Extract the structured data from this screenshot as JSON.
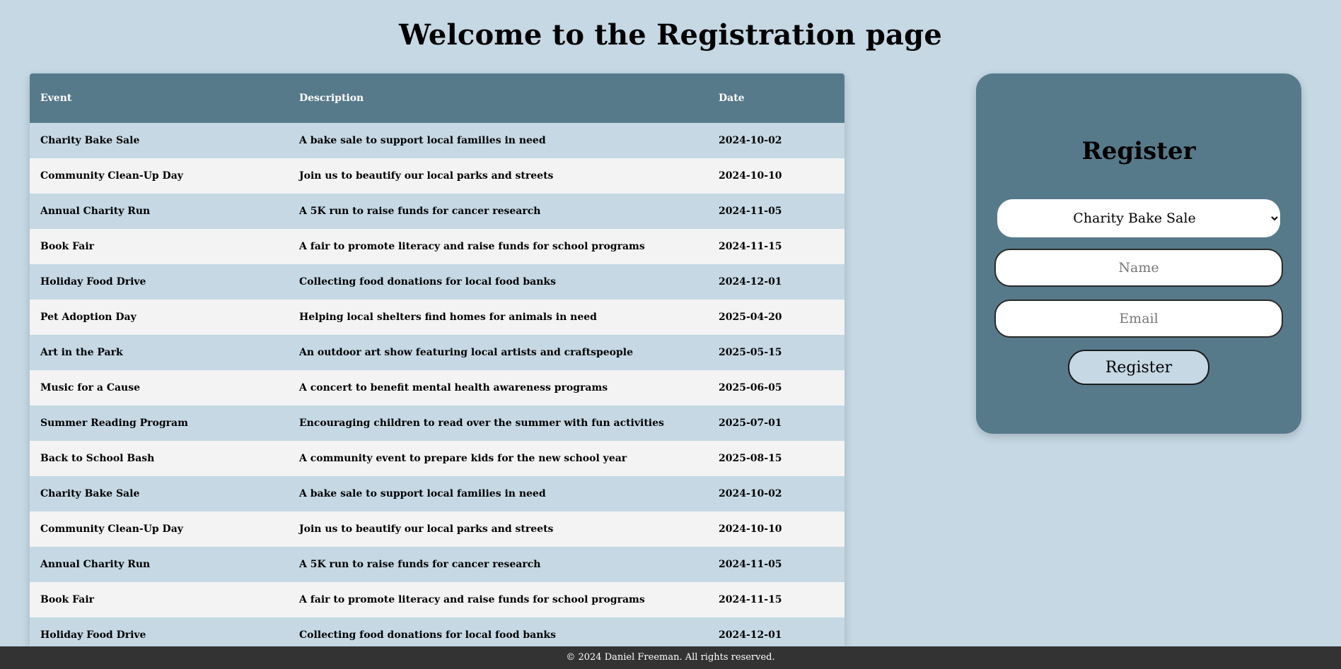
{
  "page": {
    "title": "Welcome to the Registration page"
  },
  "table": {
    "headers": {
      "event": "Event",
      "description": "Description",
      "date": "Date"
    },
    "rows": [
      {
        "event": "Charity Bake Sale",
        "description": "A bake sale to support local families in need",
        "date": "2024-10-02"
      },
      {
        "event": "Community Clean-Up Day",
        "description": "Join us to beautify our local parks and streets",
        "date": "2024-10-10"
      },
      {
        "event": "Annual Charity Run",
        "description": "A 5K run to raise funds for cancer research",
        "date": "2024-11-05"
      },
      {
        "event": "Book Fair",
        "description": "A fair to promote literacy and raise funds for school programs",
        "date": "2024-11-15"
      },
      {
        "event": "Holiday Food Drive",
        "description": "Collecting food donations for local food banks",
        "date": "2024-12-01"
      },
      {
        "event": "Pet Adoption Day",
        "description": "Helping local shelters find homes for animals in need",
        "date": "2025-04-20"
      },
      {
        "event": "Art in the Park",
        "description": "An outdoor art show featuring local artists and craftspeople",
        "date": "2025-05-15"
      },
      {
        "event": "Music for a Cause",
        "description": "A concert to benefit mental health awareness programs",
        "date": "2025-06-05"
      },
      {
        "event": "Summer Reading Program",
        "description": "Encouraging children to read over the summer with fun activities",
        "date": "2025-07-01"
      },
      {
        "event": "Back to School Bash",
        "description": "A community event to prepare kids for the new school year",
        "date": "2025-08-15"
      },
      {
        "event": "Charity Bake Sale",
        "description": "A bake sale to support local families in need",
        "date": "2024-10-02"
      },
      {
        "event": "Community Clean-Up Day",
        "description": "Join us to beautify our local parks and streets",
        "date": "2024-10-10"
      },
      {
        "event": "Annual Charity Run",
        "description": "A 5K run to raise funds for cancer research",
        "date": "2024-11-05"
      },
      {
        "event": "Book Fair",
        "description": "A fair to promote literacy and raise funds for school programs",
        "date": "2024-11-15"
      },
      {
        "event": "Holiday Food Drive",
        "description": "Collecting food donations for local food banks",
        "date": "2024-12-01"
      }
    ]
  },
  "register": {
    "title": "Register",
    "selected_event": "Charity Bake Sale",
    "name_placeholder": "Name",
    "email_placeholder": "Email",
    "button_label": "Register"
  },
  "footer": {
    "text": "© 2024 Daniel Freeman. All rights reserved."
  },
  "colors": {
    "background": "#c5d8e4",
    "header_and_card": "#577a8b",
    "row_alt": "#f3f3f3",
    "footer": "#333333"
  }
}
